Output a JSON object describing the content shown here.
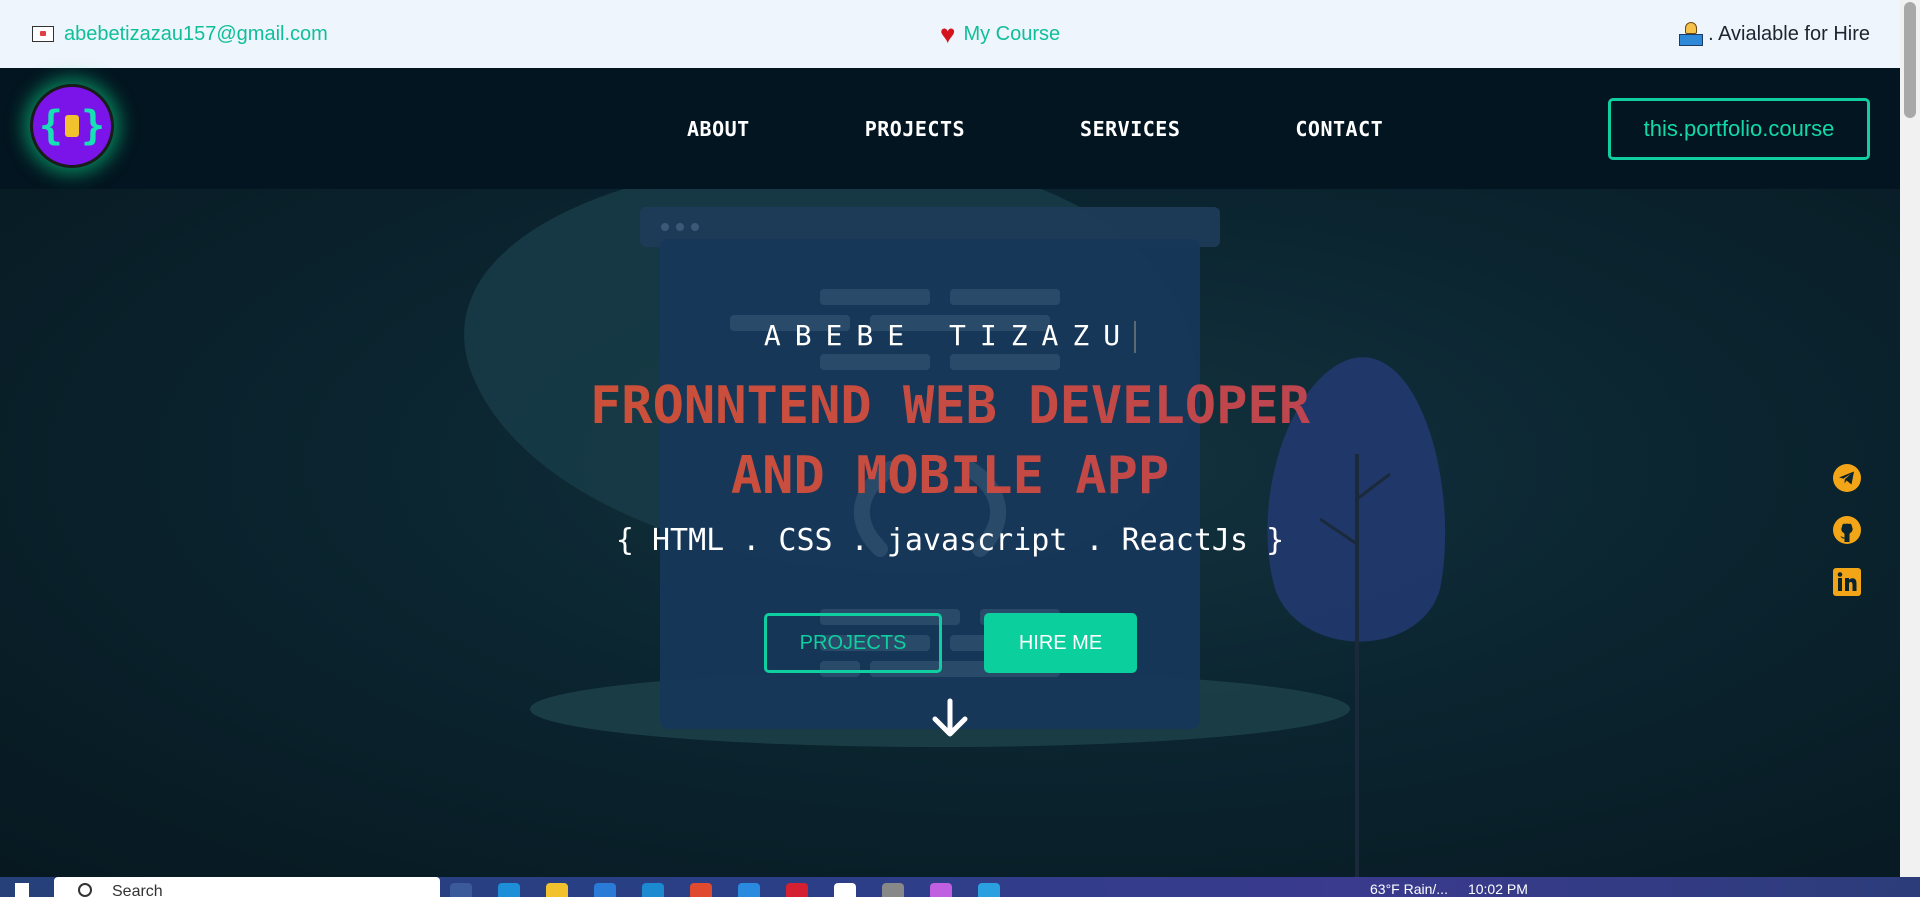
{
  "topbar": {
    "email": "abebetizazau157@gmail.com",
    "course_link": "My Course",
    "hire_status": ". Avialable for Hire"
  },
  "navbar": {
    "logo_text": "{ }",
    "links": [
      "ABOUT",
      "PROJECTS",
      "SERVICES",
      "CONTACT"
    ],
    "course_button": "this.portfolio.course"
  },
  "hero": {
    "name": "ABEBE TIZAZU",
    "role_line1": "FRONNTEND WEB DEVELOPER",
    "role_line2": "AND MOBILE APP",
    "stack": "{ HTML . CSS . javascript . ReactJs }",
    "projects_button": "PROJECTS",
    "hire_button": "HIRE ME"
  },
  "socials": [
    "telegram-icon",
    "github-icon",
    "linkedin-icon"
  ],
  "taskbar": {
    "search_placeholder": "Search",
    "weather": "63°F  Rain/...",
    "clock": "10:02 PM"
  },
  "colors": {
    "accent": "#0fcfa0",
    "navbar_bg": "#031520",
    "topbar_bg": "#eef5fc",
    "social_icon": "#f2a516",
    "role_gradient_start": "#d4582a",
    "role_gradient_end": "#a83a6a"
  }
}
